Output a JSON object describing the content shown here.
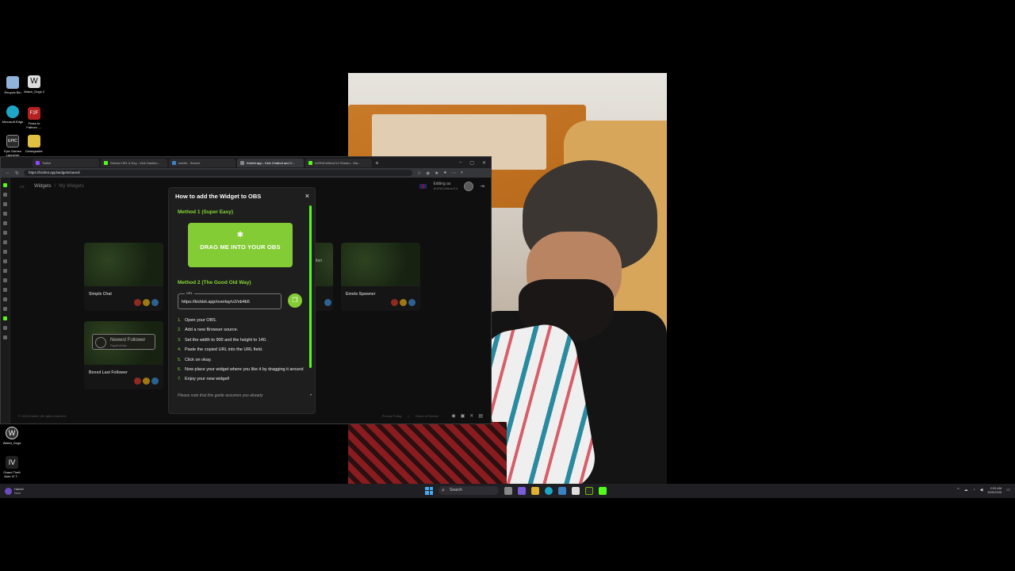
{
  "desktop_icons": [
    {
      "label": "Recycle Bin",
      "icon": "recycle-bin-icon",
      "color": "#8fb3d9"
    },
    {
      "label": "Watch_Dogs 2",
      "icon": "watch-dogs-icon",
      "color": "#dddddd"
    },
    {
      "label": "Microsoft Edge",
      "icon": "edge-icon",
      "color": "#1fa6c7"
    },
    {
      "label": "Fears to Fathom -...",
      "icon": "f2f-icon",
      "color": "#b52020"
    },
    {
      "label": "Epic Games Launcher",
      "icon": "epic-icon",
      "color": "#2a2a2a"
    },
    {
      "label": "Downgrader",
      "icon": "downgrader-icon",
      "color": "#e0c040"
    },
    {
      "label": "Watch_Dogs",
      "icon": "watch-dogs-legion-icon",
      "color": "#333333"
    },
    {
      "label": "Grand Theft Auto IV T...",
      "icon": "gta-icon",
      "color": "#222222"
    }
  ],
  "browser": {
    "tabs": [
      {
        "label": "Twitch",
        "color": "#9146ff",
        "active": false
      },
      {
        "label": "Stream URL & Key - Kick Dashbo...",
        "color": "#53fc18",
        "active": false
      },
      {
        "label": "kicklet - Search",
        "color": "#3b82c4",
        "active": false
      },
      {
        "label": "Kicklet.app - Kick Chatbot and C...",
        "color": "#888888",
        "active": true
      },
      {
        "label": "AURACelltics214 Stream - Wa...",
        "color": "#53fc18",
        "active": false
      }
    ],
    "new_tab": "+",
    "url": "https://kicklet.app/widgets/saved"
  },
  "app": {
    "crumb_root": "Widgets",
    "crumb_sep": "/",
    "crumb_current": "My Widgets",
    "editing_label": "Editing as",
    "editing_user": "AURACelltics214",
    "cards": [
      {
        "name": "Simple Chat"
      },
      {
        "name": "Emote Spawner"
      },
      {
        "name": "Boxed Last Follower"
      }
    ],
    "partial_card_text": "iber",
    "follower_badge_title": "Newest Follower",
    "follower_badge_sub": "PapaDoKicks",
    "footer_copy": "© 2025 Kicklet. All rights reserved.",
    "footer_privacy": "Privacy Policy",
    "footer_sep": "|",
    "footer_terms": "Terms of Service"
  },
  "modal": {
    "title": "How to add the Widget to OBS",
    "close": "×",
    "method1": "Method 1 (Super Easy)",
    "drag_label": "DRAG ME INTO YOUR OBS",
    "method2": "Method 2 (The Good Old Way)",
    "url_legend": "URL",
    "url_value": "https://kicklet.app/overlay/v2/nb4b5",
    "steps": [
      {
        "n": "1.",
        "text": "Open your OBS."
      },
      {
        "n": "2.",
        "text": "Add a new Browser source."
      },
      {
        "n": "3.",
        "text": "Set the width to 900 and the height to 140."
      },
      {
        "n": "4.",
        "text": "Paste the copied URL into the URL field."
      },
      {
        "n": "5.",
        "text": "Click on okay."
      },
      {
        "n": "6.",
        "text": "Now place your widget where you like it by dragging it around"
      },
      {
        "n": "7.",
        "text": "Enjoy your new widget!"
      }
    ],
    "note": "Please note that this guide assumes you already"
  },
  "taskbar": {
    "notif_title": "Hamid",
    "notif_sub": "Now",
    "search_label": "Search",
    "time": "2:09 AM",
    "date": "8/25/2025"
  },
  "colors": {
    "kick_green": "#53fc18",
    "method_green": "#83d633",
    "button_green": "#84cc35"
  }
}
